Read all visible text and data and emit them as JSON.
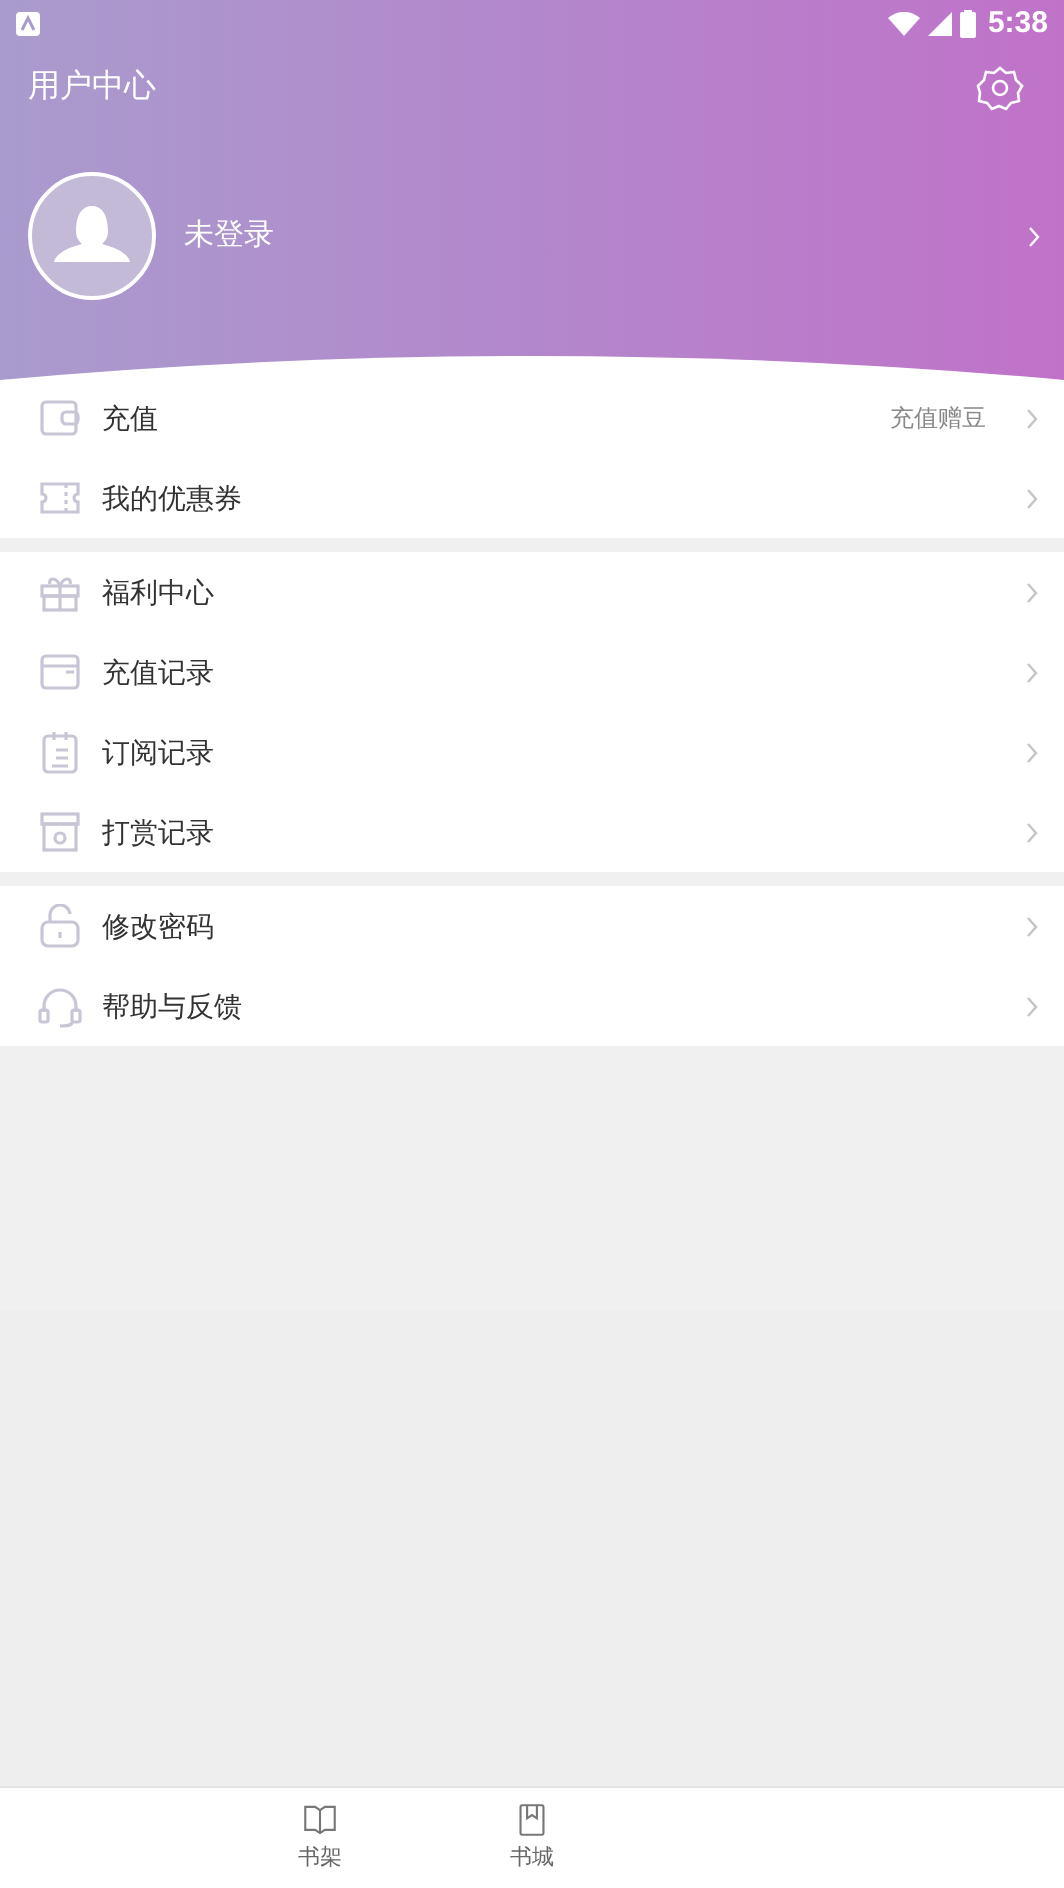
{
  "status_bar": {
    "time": "5:38"
  },
  "header": {
    "title": "用户中心",
    "user_name": "未登录"
  },
  "menu_groups": [
    {
      "items": [
        {
          "kind": "wallet",
          "label": "充值",
          "note": "充值赠豆"
        },
        {
          "kind": "coupon",
          "label": "我的优惠券"
        }
      ]
    },
    {
      "items": [
        {
          "kind": "gift",
          "label": "福利中心"
        },
        {
          "kind": "card",
          "label": "充值记录"
        },
        {
          "kind": "clipboard",
          "label": "订阅记录"
        },
        {
          "kind": "box",
          "label": "打赏记录"
        }
      ]
    },
    {
      "items": [
        {
          "kind": "lock",
          "label": "修改密码"
        },
        {
          "kind": "headset",
          "label": "帮助与反馈"
        }
      ]
    }
  ],
  "bottom_nav": [
    {
      "kind": "book",
      "label": "书架"
    },
    {
      "kind": "bookmark",
      "label": "书城"
    }
  ]
}
